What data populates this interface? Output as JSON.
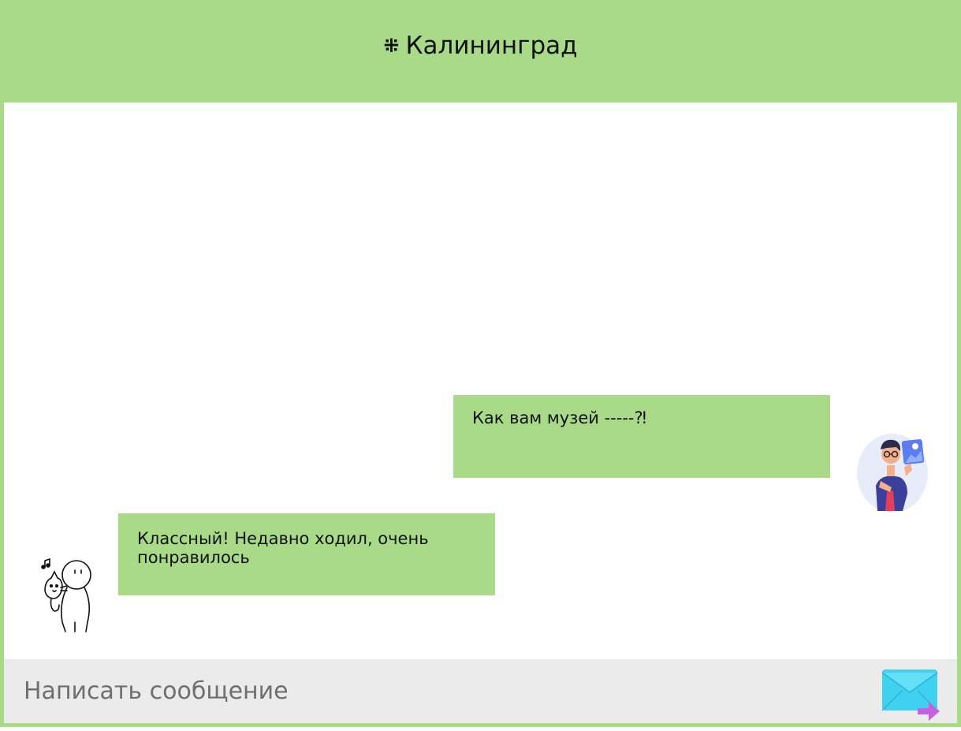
{
  "header": {
    "hash_symbol": "⁜",
    "title": "Калининград"
  },
  "messages": [
    {
      "text": "Как вам музей -----⁈",
      "side": "right",
      "avatar": "person-holding-photo-icon"
    },
    {
      "text": "Классный! Недавно ходил, очень понравилось",
      "side": "left",
      "avatar": "person-hugging-cat-icon"
    }
  ],
  "composer": {
    "placeholder": "Написать сообщение",
    "send_icon": "envelope-send-icon"
  },
  "colors": {
    "accent": "#a8da88",
    "composer_bg": "#ebebeb",
    "send_envelope": "#40d0f0",
    "send_arrow": "#c860e0"
  }
}
